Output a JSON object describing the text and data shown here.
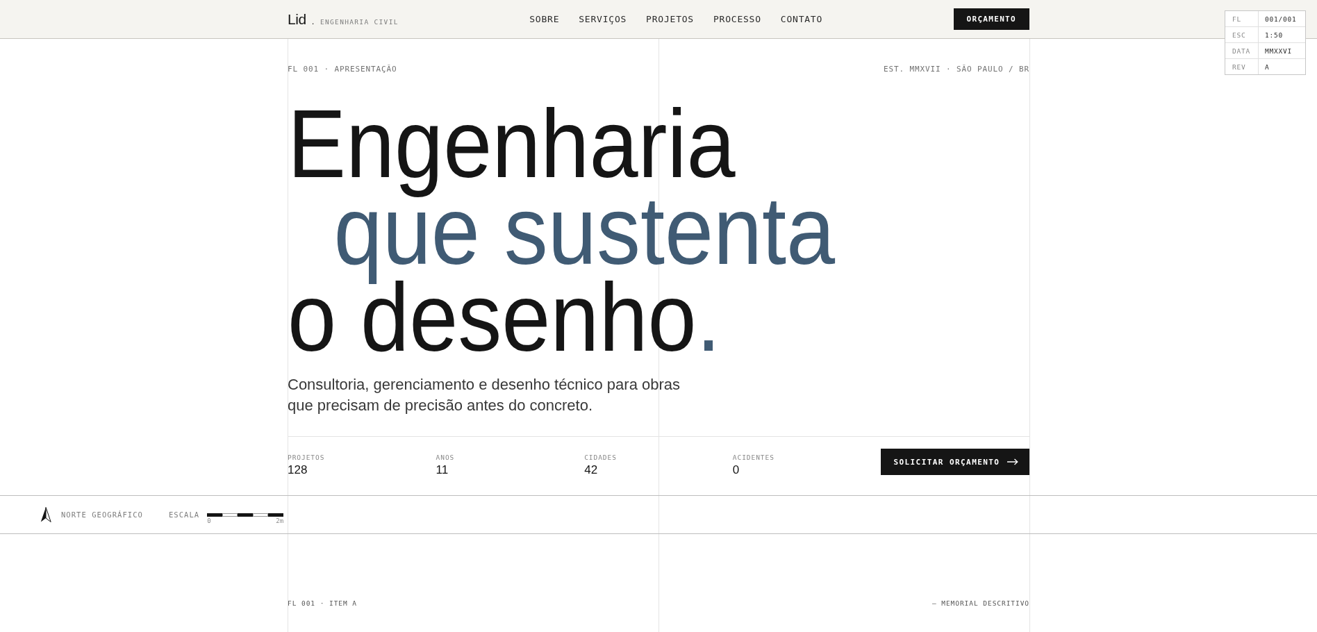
{
  "header": {
    "logo": {
      "wordmark": "Lid",
      "mark": ".",
      "tagline": "ENGENHARIA CIVIL"
    },
    "nav": [
      "SOBRE",
      "SERVIÇOS",
      "PROJETOS",
      "PROCESSO",
      "CONTATO"
    ],
    "cta": "ORÇAMENTO"
  },
  "sheet_info": [
    {
      "label": "FL",
      "value": "001/001"
    },
    {
      "label": "ESC",
      "value": "1:50"
    },
    {
      "label": "DATA",
      "value": "MMXXVI"
    },
    {
      "label": "REV",
      "value": "A"
    }
  ],
  "hero": {
    "sheet_label": "FL 001 · APRESENTAÇÃO",
    "location": "EST. MMXVII · SÃO PAULO / BR",
    "headline": {
      "lines": [
        {
          "text": "Engenharia",
          "kind": "plain"
        },
        {
          "text": "que sustenta",
          "kind": "accent"
        },
        {
          "text": "o desenho",
          "kind": "plain"
        }
      ],
      "end_mark": "."
    },
    "lead": "Consultoria, gerenciamento e desenho técnico para obras que precisam de precisão antes do concreto.",
    "stats": [
      {
        "label": "PROJETOS",
        "value": "128"
      },
      {
        "label": "ANOS",
        "value": "11"
      },
      {
        "label": "CIDADES",
        "value": "42"
      },
      {
        "label": "ACIDENTES",
        "value": "0"
      }
    ],
    "cta": "SOLICITAR ORÇAMENTO"
  },
  "legend": {
    "north": "NORTE GEOGRÁFICO",
    "scale_label": "ESCALA",
    "scale_start": "0",
    "scale_end": "2m"
  },
  "section": {
    "sheet_label": "FL 001 · ITEM A",
    "title": "— MEMORIAL DESCRITIVO"
  }
}
